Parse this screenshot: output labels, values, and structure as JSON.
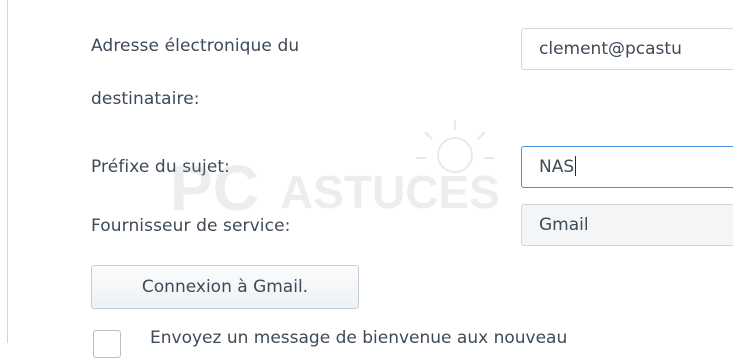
{
  "form": {
    "recipient_label_line1": "Adresse électronique du",
    "recipient_label_line2": "destinataire:",
    "recipient_value": "clement@pcastu",
    "subject_prefix_label": "Préfixe du sujet:",
    "subject_prefix_value": "NAS",
    "provider_label": "Fournisseur de service:",
    "provider_value": "Gmail",
    "connect_button_label": "Connexion à Gmail.",
    "welcome_checkbox_label": "Envoyez un message de bienvenue aux nouveau"
  },
  "watermark": {
    "text_pc": "PC",
    "text_astuces": "ASTUCES",
    "icon": "lightbulb-icon"
  },
  "colors": {
    "text": "#3d4a57",
    "border": "#cfd6de",
    "focus_border": "#4a90e2"
  }
}
